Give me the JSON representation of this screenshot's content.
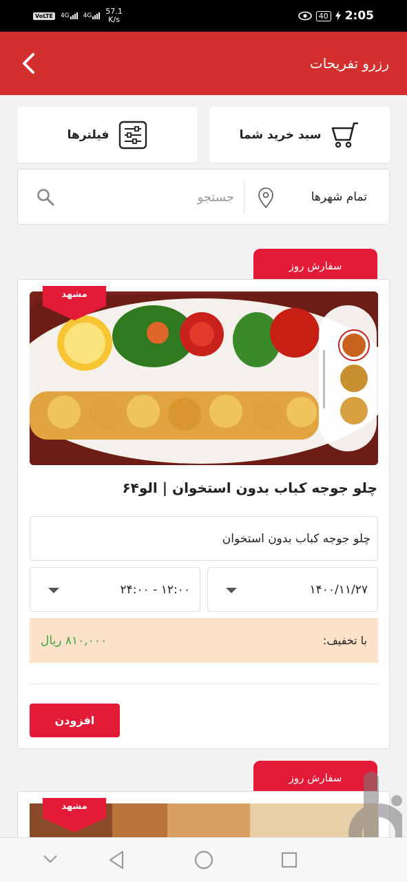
{
  "status_bar": {
    "volte": "VoLTE",
    "net1": "4G",
    "net2": "4G",
    "speed_value": "57.1",
    "speed_unit": "K/s",
    "battery": "40",
    "time": "2:05"
  },
  "app_bar": {
    "title": "رزرو تفریحات"
  },
  "actions": {
    "cart_label": "سبد خرید شما",
    "filters_label": "فیلترها"
  },
  "search": {
    "city": "تمام شهرها",
    "placeholder": "جستجو"
  },
  "cards": [
    {
      "tab_label": "سفارش روز",
      "city_badge": "مشهد",
      "title": "چلو جوجه کباب بدون استخوان | الو۶۴",
      "description": "چلو جوجه کباب بدون استخوان",
      "date": "۱۴۰۰/۱۱/۲۷",
      "time_range": "۱۲:۰۰ - ۲۴:۰۰",
      "discount_label": "با تخفیف:",
      "price": "۸۱۰,۰۰۰ ریال",
      "add_label": "افزودن"
    },
    {
      "tab_label": "سفارش روز",
      "city_badge": "مشهد"
    }
  ],
  "colors": {
    "primary": "#d32f2f",
    "accent": "#e31b38",
    "price": "#3da33d",
    "discount_bg": "#fde1c8"
  }
}
